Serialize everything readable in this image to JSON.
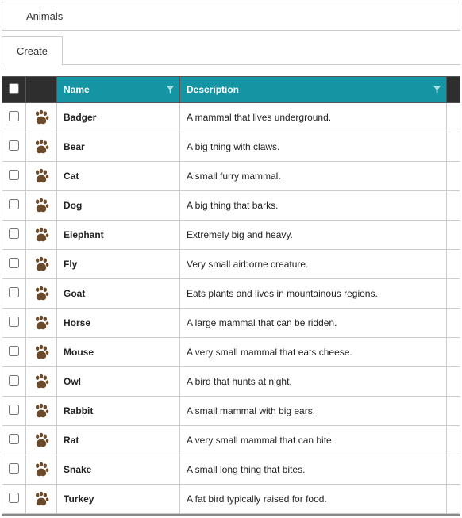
{
  "header": {
    "title": "Animals"
  },
  "toolbar": {
    "create_label": "Create"
  },
  "icons": {
    "row_icon": "paw-icon"
  },
  "columns": {
    "name_label": "Name",
    "description_label": "Description"
  },
  "rows": [
    {
      "name": "Badger",
      "description": "A mammal that lives underground."
    },
    {
      "name": "Bear",
      "description": "A big thing with claws."
    },
    {
      "name": "Cat",
      "description": "A small furry mammal."
    },
    {
      "name": "Dog",
      "description": "A big thing that barks."
    },
    {
      "name": "Elephant",
      "description": "Extremely big and heavy."
    },
    {
      "name": "Fly",
      "description": "Very small airborne creature."
    },
    {
      "name": "Goat",
      "description": "Eats plants and lives in mountainous regions."
    },
    {
      "name": "Horse",
      "description": "A large mammal that can be ridden."
    },
    {
      "name": "Mouse",
      "description": "A very small mammal that eats cheese."
    },
    {
      "name": "Owl",
      "description": "A bird that hunts at night."
    },
    {
      "name": "Rabbit",
      "description": "A small mammal with big ears."
    },
    {
      "name": "Rat",
      "description": "A very small mammal that can bite."
    },
    {
      "name": "Snake",
      "description": "A small long thing that bites."
    },
    {
      "name": "Turkey",
      "description": "A fat bird typically raised for food."
    }
  ]
}
